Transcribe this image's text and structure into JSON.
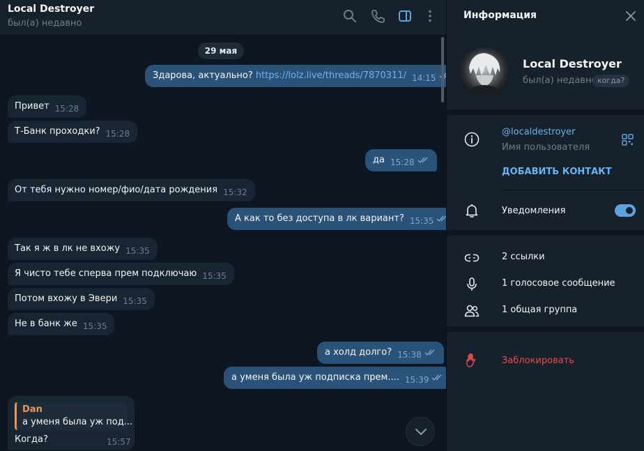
{
  "chat": {
    "title": "Local Destroyer",
    "status": "был(а) недавно",
    "icons": [
      "search-icon",
      "phone-icon",
      "sidebar-toggle-icon",
      "more-icon"
    ],
    "date": "29 мая",
    "messages": [
      {
        "dir": "out",
        "text": "Здарова, актуально? ",
        "link": "https://lolz.live/threads/7870311/",
        "time": "14:15"
      },
      {
        "dir": "in",
        "text": "Привет",
        "time": "15:28"
      },
      {
        "dir": "in",
        "text": "Т-Банк проходки?",
        "time": "15:28"
      },
      {
        "dir": "out",
        "text": "да",
        "time": "15:28"
      },
      {
        "dir": "in",
        "text": "От тебя нужно номер/фио/дата рождения",
        "time": "15:32"
      },
      {
        "dir": "out",
        "text": "А как то без доступа в лк вариант?",
        "time": "15:35"
      },
      {
        "dir": "in",
        "text": "Так я ж в лк не вхожу",
        "time": "15:35"
      },
      {
        "dir": "in",
        "text": "Я чисто тебе сперва прем подключаю",
        "time": "15:35"
      },
      {
        "dir": "in",
        "text": "Потом вхожу в Эвери",
        "time": "15:35"
      },
      {
        "dir": "in",
        "text": "Не в банк же",
        "time": "15:35"
      },
      {
        "dir": "out",
        "text": "а холд долго?",
        "time": "15:38"
      },
      {
        "dir": "out",
        "text": "а  уменя была уж подписка прем....",
        "time": "15:39"
      }
    ],
    "reply": {
      "quote_name": "Dan",
      "quote_text": "а  уменя была уж под...",
      "text": "Когда?",
      "time": "15:57"
    }
  },
  "info": {
    "title": "Информация",
    "name": "Local Destroyer",
    "status": "был(а) недавно",
    "when_chip": "когда?",
    "username": "@localdestroyer",
    "username_label": "Имя пользователя",
    "add_contact": "ДОБАВИТЬ КОНТАКТ",
    "notifications_label": "Уведомления",
    "notifications_on": true,
    "links": "2 ссылки",
    "voice": "1 голосовое сообщение",
    "groups": "1 общая группа",
    "block": "Заблокировать",
    "colors": {
      "accent": "#6ab3f3",
      "danger": "#e84c4c",
      "bubble_out": "#2b5278",
      "bubble_in": "#182533"
    }
  }
}
